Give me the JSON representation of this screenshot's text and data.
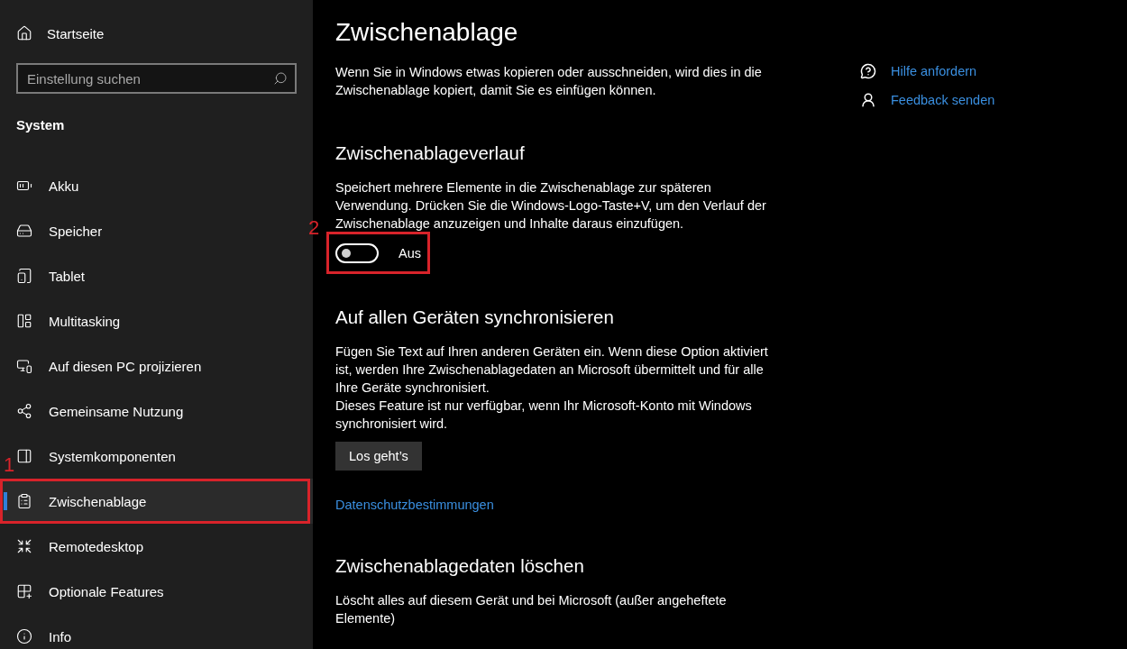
{
  "sidebar": {
    "home": {
      "label": "Startseite"
    },
    "search": {
      "placeholder": "Einstellung suchen"
    },
    "section": "System",
    "items": [
      {
        "label": "Akku",
        "selected": false
      },
      {
        "label": "Speicher",
        "selected": false
      },
      {
        "label": "Tablet",
        "selected": false
      },
      {
        "label": "Multitasking",
        "selected": false
      },
      {
        "label": "Auf diesen PC projizieren",
        "selected": false
      },
      {
        "label": "Gemeinsame Nutzung",
        "selected": false
      },
      {
        "label": "Systemkomponenten",
        "selected": false
      },
      {
        "label": "Zwischenablage",
        "selected": true,
        "annotation": "1"
      },
      {
        "label": "Remotedesktop",
        "selected": false
      },
      {
        "label": "Optionale Features",
        "selected": false
      },
      {
        "label": "Info",
        "selected": false
      }
    ]
  },
  "main": {
    "title": "Zwischenablage",
    "intro": "Wenn Sie in Windows etwas kopieren oder ausschneiden, wird dies in die Zwischenablage kopiert, damit Sie es einfügen können.",
    "sections": [
      {
        "kind": "toggle",
        "heading": "Zwischenablageverlauf",
        "paragraphs": [
          "Speichert mehrere Elemente in die Zwischenablage zur späteren Verwendung. Drücken Sie die Windows-Logo-Taste+V, um den Verlauf der Zwischenablage anzuzeigen und Inhalte daraus einzufügen."
        ],
        "toggle": {
          "on": false,
          "label": "Aus",
          "annotation": "2"
        }
      },
      {
        "kind": "sync",
        "heading": "Auf allen Geräten synchronisieren",
        "paragraphs": [
          "Fügen Sie Text auf Ihren anderen Geräten ein. Wenn diese Option aktiviert ist, werden Ihre Zwischenablagedaten an Microsoft übermittelt und für alle Ihre Geräte synchronisiert.",
          "Dieses Feature ist nur verfügbar, wenn Ihr Microsoft-Konto mit Windows synchronisiert wird."
        ],
        "button": "Los geht’s",
        "link": "Datenschutzbestimmungen"
      },
      {
        "kind": "text",
        "heading": "Zwischenablagedaten löschen",
        "paragraphs": [
          "Löscht alles auf diesem Gerät und bei Microsoft (außer angeheftete Elemente)"
        ]
      }
    ]
  },
  "links": [
    {
      "label": "Hilfe anfordern"
    },
    {
      "label": "Feedback senden"
    }
  ]
}
